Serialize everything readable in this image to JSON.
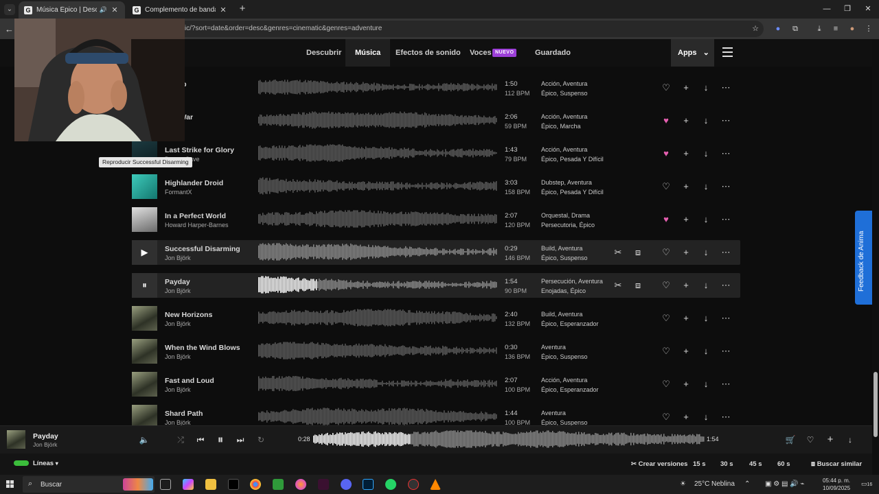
{
  "browser": {
    "tabs": [
      {
        "title": "Música Épico | Descarga sin",
        "favicon": "G",
        "active": true
      },
      {
        "title": "Complemento de bandas sonoras",
        "favicon": "G",
        "active": false
      }
    ],
    "url": "...pic/?sort=date&order=desc&genres=cinematic&genres=adventure"
  },
  "nav": {
    "items": [
      "Descubrir",
      "Música",
      "Efectos de sonido",
      "Voces",
      "Guardado"
    ],
    "active": "Música",
    "badge": "NUEVO",
    "apps_label": "Apps"
  },
  "tooltip": "Reproducir Successful Disarming",
  "tracks": [
    {
      "title": "...e Up",
      "artist": "...rk",
      "duration": "1:50",
      "bpm": "112 BPM",
      "g1": [
        "Acción",
        "Aventura"
      ],
      "g2": [
        "Épico",
        "Suspenso"
      ],
      "liked": false,
      "thumb": "cave"
    },
    {
      "title": "...of War",
      "artist": "...Cave",
      "duration": "2:06",
      "bpm": "59 BPM",
      "g1": [
        "Acción",
        "Aventura"
      ],
      "g2": [
        "Épico",
        "Marcha"
      ],
      "liked": true,
      "thumb": "cave"
    },
    {
      "title": "Last Strike for Glory",
      "artist": "Dream Cave",
      "duration": "1:43",
      "bpm": "79 BPM",
      "g1": [
        "Acción",
        "Aventura"
      ],
      "g2": [
        "Épico",
        "Pesada Y Difícil"
      ],
      "liked": true,
      "thumb": "cave"
    },
    {
      "title": "Highlander Droid",
      "artist": "FormantX",
      "duration": "3:03",
      "bpm": "158 BPM",
      "g1": [
        "Dubstep",
        "Aventura"
      ],
      "g2": [
        "Épico",
        "Pesada Y Difícil"
      ],
      "liked": false,
      "thumb": "droid"
    },
    {
      "title": "In a Perfect World",
      "artist": "Howard Harper-Barnes",
      "duration": "2:07",
      "bpm": "120 BPM",
      "g1": [
        "Orquestal",
        "Drama"
      ],
      "g2": [
        "Persecutoria",
        "Épico"
      ],
      "liked": true,
      "thumb": "world"
    },
    {
      "title": "Successful Disarming",
      "artist": "Jon Björk",
      "duration": "0:29",
      "bpm": "146 BPM",
      "g1": [
        "Build",
        "Aventura"
      ],
      "g2": [
        "Épico",
        "Suspenso"
      ],
      "liked": false,
      "thumb": "mist",
      "state": "hover"
    },
    {
      "title": "Payday",
      "artist": "Jon Björk",
      "duration": "1:54",
      "bpm": "90 BPM",
      "g1": [
        "Persecución",
        "Aventura"
      ],
      "g2": [
        "Enojadas",
        "Épico"
      ],
      "liked": false,
      "thumb": "mist",
      "state": "playing"
    },
    {
      "title": "New Horizons",
      "artist": "Jon Björk",
      "duration": "2:40",
      "bpm": "132 BPM",
      "g1": [
        "Build",
        "Aventura"
      ],
      "g2": [
        "Épico",
        "Esperanzador"
      ],
      "liked": false,
      "thumb": "mist"
    },
    {
      "title": "When the Wind Blows",
      "artist": "Jon Björk",
      "duration": "0:30",
      "bpm": "136 BPM",
      "g1": [
        "Aventura"
      ],
      "g2": [
        "Épico",
        "Suspenso"
      ],
      "liked": false,
      "thumb": "mist"
    },
    {
      "title": "Fast and Loud",
      "artist": "Jon Björk",
      "duration": "2:07",
      "bpm": "100 BPM",
      "g1": [
        "Acción",
        "Aventura"
      ],
      "g2": [
        "Épico",
        "Esperanzador"
      ],
      "liked": false,
      "thumb": "mist"
    },
    {
      "title": "Shard Path",
      "artist": "Jon Björk",
      "duration": "1:44",
      "bpm": "100 BPM",
      "g1": [
        "Aventura"
      ],
      "g2": [
        "Épico",
        "Suspenso"
      ],
      "liked": false,
      "thumb": "mist"
    }
  ],
  "player": {
    "title": "Payday",
    "artist": "Jon Björk",
    "elapsed": "0:28",
    "total": "1:54",
    "progress": 0.246
  },
  "footer": {
    "lines_label": "Líneas",
    "create_versions": "Crear versiones",
    "durations": [
      "15 s",
      "30 s",
      "45 s",
      "60 s"
    ],
    "find_similar": "Buscar similar"
  },
  "feedback_label": "Feedback de Anima",
  "taskbar": {
    "search_label": "Buscar",
    "weather": "25°C",
    "weather_desc": "Neblina",
    "time": "05:44 p. m.",
    "date": "10/09/2025",
    "notif": "16"
  },
  "colors": {
    "liked": "#e55fb0",
    "badge": "#9c3fd8",
    "feedback": "#1f6fd8",
    "lines": "#3bbd3b"
  }
}
